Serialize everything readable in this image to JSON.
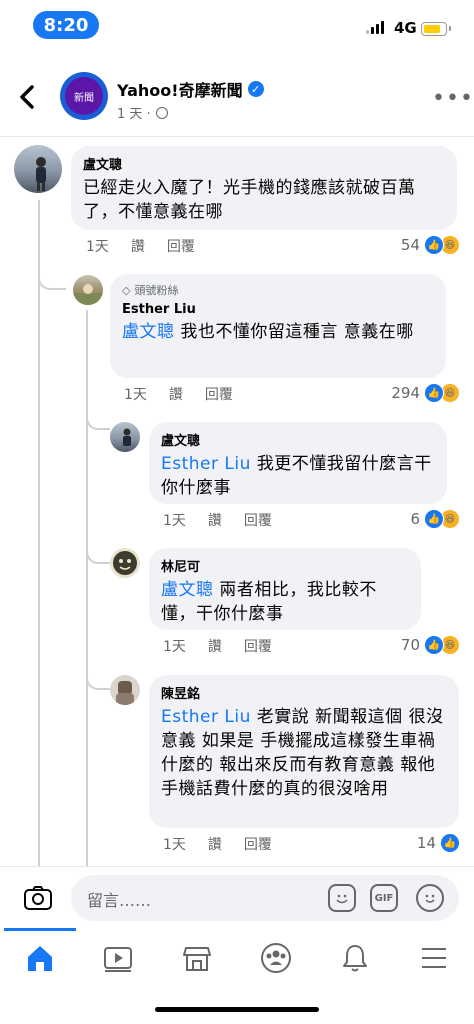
{
  "status_bar": {
    "time": "8:20",
    "network": "4G"
  },
  "header": {
    "page_name": "Yahoo!奇摩新聞",
    "avatar_text": "新聞",
    "post_time": "1 天 ·"
  },
  "comments": [
    {
      "author": "盧文聰",
      "text": "已經走火入魔了！光手機的錢應該就破百萬了，不懂意義在哪",
      "time": "1天",
      "like_label": "讚",
      "reply_label": "回覆",
      "reaction_count": "54"
    },
    {
      "badge": "頭號粉絲",
      "author": "Esther Liu",
      "mention": "盧文聰",
      "text": "我也不懂你留這種言 意義在哪",
      "time": "1天",
      "like_label": "讚",
      "reply_label": "回覆",
      "reaction_count": "294"
    },
    {
      "author": "盧文聰",
      "mention": "Esther Liu",
      "text": "我更不懂我留什麼言干你什麼事",
      "time": "1天",
      "like_label": "讚",
      "reply_label": "回覆",
      "reaction_count": "6"
    },
    {
      "author": "林尼可",
      "mention": "盧文聰",
      "text": "兩者相比，我比較不懂，干你什麼事",
      "time": "1天",
      "like_label": "讚",
      "reply_label": "回覆",
      "reaction_count": "70"
    },
    {
      "author": "陳昱銘",
      "mention": "Esther Liu",
      "text": "老實說 新聞報這個 很沒意義 如果是 手機擺成這樣發生車禍什麼的 報出來反而有教育意義 報他手機話費什麼的真的很沒啥用",
      "time": "1天",
      "like_label": "讚",
      "reply_label": "回覆",
      "reaction_count": "14"
    }
  ],
  "composer": {
    "placeholder": "留言……",
    "gif_label": "GIF"
  },
  "colors": {
    "accent": "#1877f2",
    "bubble": "#f0f2f5",
    "secondary_text": "#65676b"
  },
  "icons": [
    "back-icon",
    "verified-icon",
    "globe-icon",
    "more-icon",
    "camera-icon",
    "sticker-icon",
    "gif-icon",
    "emoji-icon",
    "home-icon",
    "watch-icon",
    "marketplace-icon",
    "groups-icon",
    "notifications-icon",
    "menu-icon"
  ]
}
